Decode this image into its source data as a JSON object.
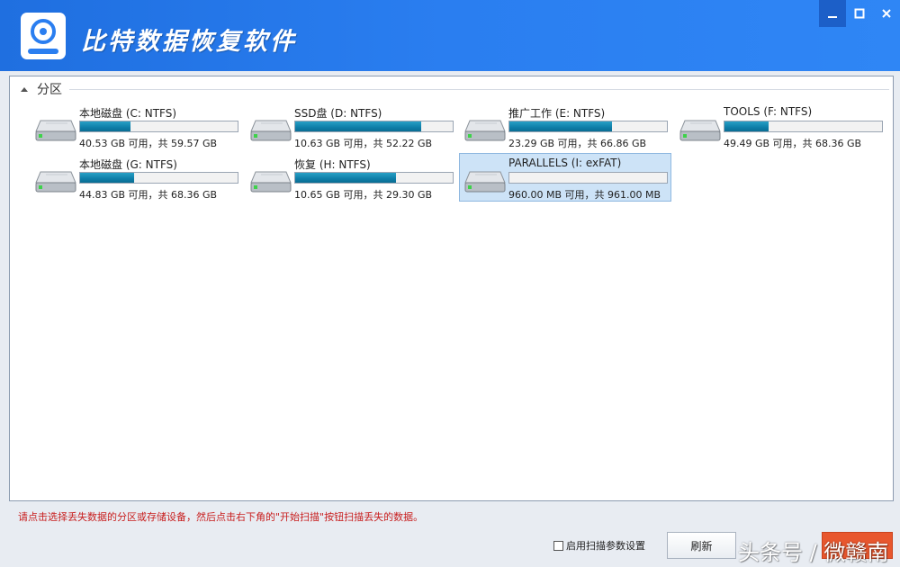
{
  "app": {
    "title": "比特数据恢复软件",
    "window_controls": [
      "minimize-icon",
      "maximize-icon",
      "close-icon"
    ]
  },
  "partitions": {
    "group_label": "分区",
    "drives": [
      {
        "name": "本地磁盘 (C: NTFS)",
        "info": "40.53 GB 可用，共 59.57 GB",
        "used_fraction": 0.32
      },
      {
        "name": "SSD盘 (D: NTFS)",
        "info": "10.63 GB 可用，共 52.22 GB",
        "used_fraction": 0.8
      },
      {
        "name": "推广工作 (E: NTFS)",
        "info": "23.29 GB 可用，共 66.86 GB",
        "used_fraction": 0.65
      },
      {
        "name": "TOOLS (F: NTFS)",
        "info": "49.49 GB 可用，共 68.36 GB",
        "used_fraction": 0.28
      },
      {
        "name": "本地磁盘 (G: NTFS)",
        "info": "44.83 GB 可用，共 68.36 GB",
        "used_fraction": 0.34
      },
      {
        "name": "恢复 (H: NTFS)",
        "info": "10.65 GB 可用，共 29.30 GB",
        "used_fraction": 0.64
      },
      {
        "name": "PARALLELS (I: exFAT)",
        "info": "960.00 MB 可用，共 961.00 MB",
        "used_fraction": 0.0,
        "selected": true
      }
    ]
  },
  "footer": {
    "hint": "请点击选择丢失数据的分区或存储设备，然后点击右下角的\"开始扫描\"按钮扫描丢失的数据。",
    "scan_params_label": "启用扫描参数设置",
    "refresh_label": "刷新"
  },
  "watermark": {
    "text": "头条号 / 微赣南"
  },
  "colors": {
    "titlebar": "#2a7ef0",
    "bar_fill": "#0e7ea8",
    "hint": "#c81e1e",
    "start_button": "#e8572e",
    "selected_bg": "#cde3f7"
  }
}
